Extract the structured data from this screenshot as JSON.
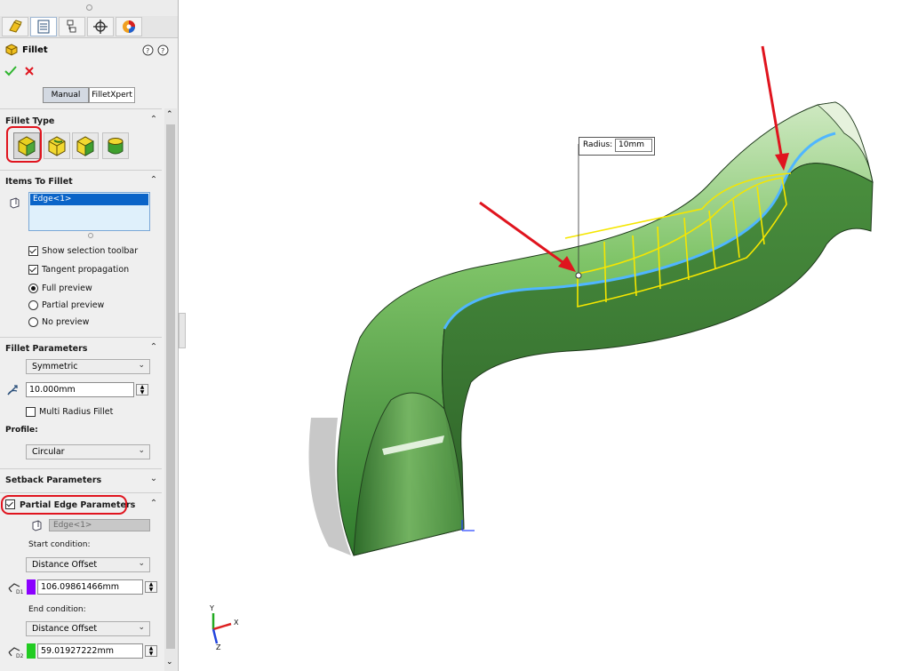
{
  "tabs": [
    {
      "icon": "feature-manager-icon",
      "active": false
    },
    {
      "icon": "property-manager-icon",
      "active": true
    },
    {
      "icon": "configuration-manager-icon",
      "active": false
    },
    {
      "icon": "dimxpert-icon",
      "active": false
    },
    {
      "icon": "display-manager-icon",
      "active": false
    }
  ],
  "header": {
    "title": "Fillet"
  },
  "mode_buttons": {
    "manual": "Manual",
    "filletxpert": "FilletXpert"
  },
  "fillet_type": {
    "title": "Fillet Type",
    "selected_index": 0
  },
  "items_to_fillet": {
    "title": "Items To Fillet",
    "selection": "Edge<1>",
    "show_selection_toolbar": "Show selection toolbar",
    "tangent_propagation": "Tangent propagation",
    "full_preview": "Full preview",
    "partial_preview": "Partial preview",
    "no_preview": "No preview"
  },
  "fillet_parameters": {
    "title": "Fillet Parameters",
    "method": "Symmetric",
    "radius": "10.000mm",
    "multi_radius": "Multi Radius Fillet",
    "profile_label": "Profile:",
    "profile": "Circular"
  },
  "setback": {
    "title": "Setback Parameters"
  },
  "partial_edge": {
    "title": "Partial Edge Parameters",
    "edge": "Edge<1>",
    "start_label": "Start condition:",
    "start_condition": "Distance Offset",
    "d1_value": "106.09861466mm",
    "d1_color": "#8b00ff",
    "end_label": "End condition:",
    "end_condition": "Distance Offset",
    "d2_value": "59.01927222mm",
    "d2_color": "#22cc22"
  },
  "viewport": {
    "radius_label": "Radius:",
    "radius_value": "10mm",
    "triad_labels": {
      "x": "X",
      "y": "Y",
      "z": "Z"
    }
  },
  "colors": {
    "accent_red": "#e0141e",
    "selection_blue": "#0a64c8",
    "preview_yellow": "#f5e600",
    "body_green": "#3f8f3a"
  }
}
